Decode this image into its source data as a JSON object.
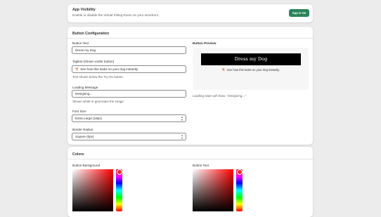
{
  "visibility": {
    "title": "App Visibility",
    "description": "Enable or disable the Virtual Fitting Room on your storefront.",
    "status_badge": "App is On"
  },
  "config": {
    "title": "Button Configuration",
    "button_text": {
      "label": "Button Text",
      "value": "Dress my Dog"
    },
    "tagline": {
      "label": "Tagline (shown under button)",
      "value": "See how this looks on your dog instantly",
      "emoji": "🐕",
      "help": "Text shown below the Try-On button"
    },
    "loading": {
      "label": "Loading Message",
      "value": "Designing...",
      "help": "Shown while AI generates the image"
    },
    "font_size": {
      "label": "Font Size",
      "value": "Extra Large (18px)"
    },
    "border_radius": {
      "label": "Border Radius",
      "value": "Square (0px)"
    }
  },
  "preview": {
    "title": "Button Preview",
    "button_label": "Dress my Dog",
    "tagline": "See how this looks on your dog instantly",
    "loading_note": "Loading state will show: \"Designing...\""
  },
  "colors": {
    "title": "Colors",
    "button_background_label": "Button Background",
    "button_text_label": "Button Text",
    "accent": "#29845a"
  }
}
